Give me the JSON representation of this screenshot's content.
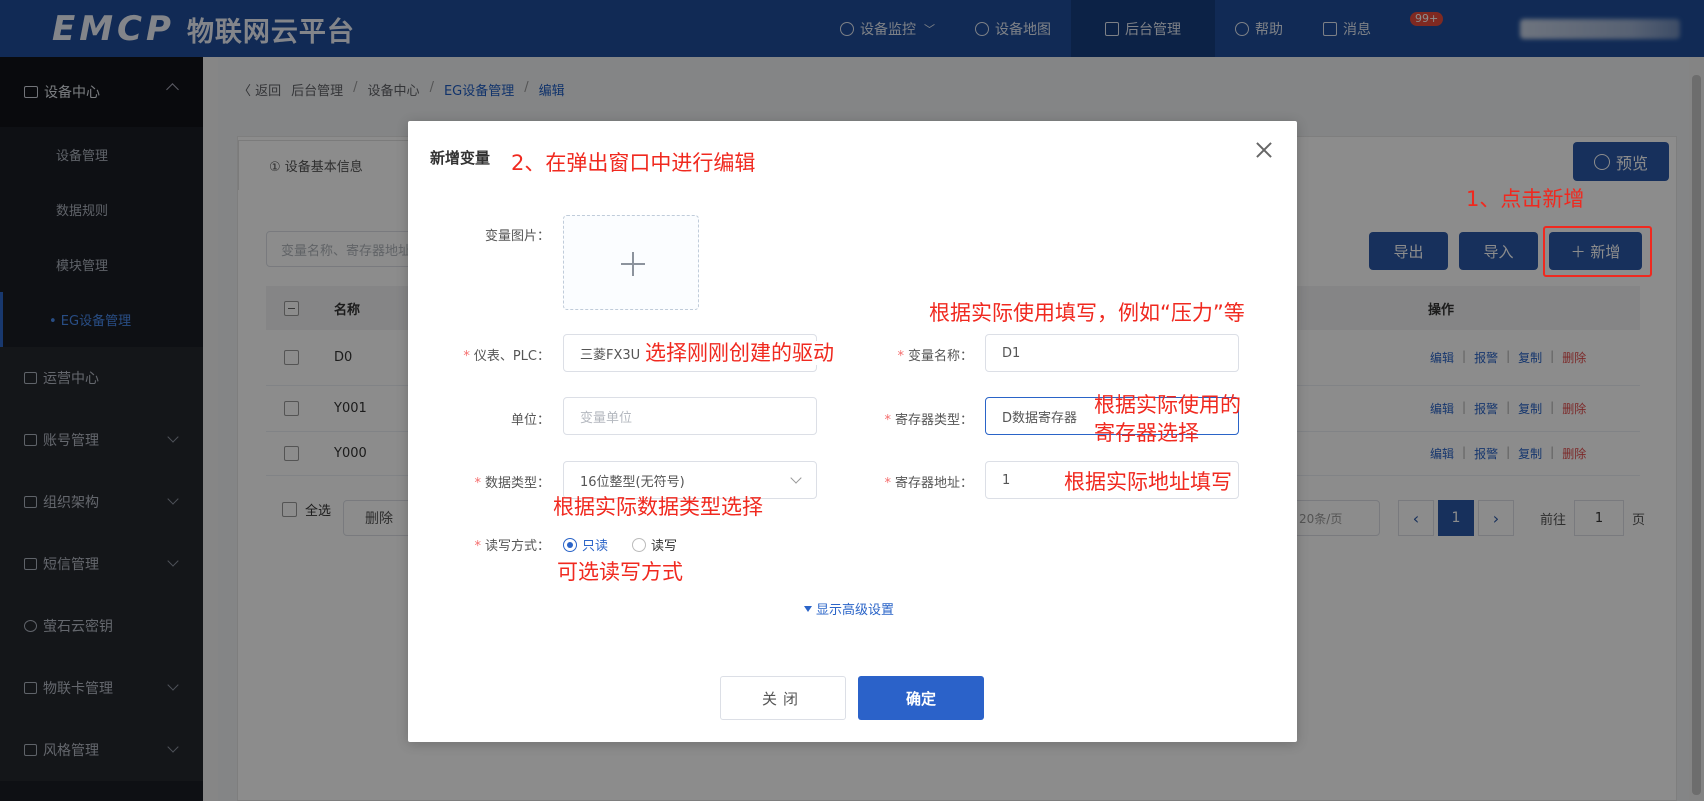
{
  "header": {
    "logo_mark": "EMCP",
    "logo_text": "物联网云平台",
    "nav": [
      {
        "label": "设备监控",
        "icon": "location-pin-icon"
      },
      {
        "label": "设备地图",
        "icon": "user-icon"
      },
      {
        "label": "后台管理",
        "icon": "monitor-icon",
        "active": true
      },
      {
        "label": "帮助",
        "icon": "help-icon"
      },
      {
        "label": "消息",
        "icon": "message-icon"
      }
    ],
    "badge": "99+"
  },
  "sidebar": {
    "group": "设备中心",
    "subitems": [
      "设备管理",
      "数据规则",
      "模块管理",
      "• EG设备管理"
    ],
    "menus": [
      "运营中心",
      "账号管理",
      "组织架构",
      "短信管理",
      "萤石云密钥",
      "物联卡管理",
      "风格管理"
    ]
  },
  "breadcrumb": {
    "back": "〈 返回",
    "items": [
      "后台管理",
      "/",
      "设备中心",
      "/",
      "EG设备管理",
      "/",
      "编辑"
    ]
  },
  "page": {
    "tab_basic": "① 设备基本信息",
    "preview": "预览",
    "export": "导出",
    "import": "导入",
    "add": "＋ 新增",
    "search_placeholder": "变量名称、寄存器地址",
    "table": {
      "col_name": "名称",
      "col_ops": "操作",
      "rows": [
        "D0",
        "Y001",
        "Y000"
      ],
      "ops": [
        "编辑",
        "报警",
        "复制",
        "删除"
      ]
    },
    "select_all": "全选",
    "delete": "删除",
    "page_size": "20条/页",
    "prev": "‹",
    "current_page": "1",
    "next": "›",
    "goto_label": "前往",
    "goto_value": "1",
    "page_unit": "页"
  },
  "dialog": {
    "title": "新增变量",
    "labels": {
      "image": "变量图片：",
      "plc": "仪表、PLC：",
      "var_name": "变量名称：",
      "unit": "单位：",
      "reg_type": "寄存器类型：",
      "data_type": "数据类型：",
      "reg_addr": "寄存器地址：",
      "rw": "读写方式："
    },
    "values": {
      "plc": "三菱FX3U",
      "var_name": "D1",
      "unit_placeholder": "变量单位",
      "reg_type": "D数据寄存器",
      "data_type": "16位整型(无符号)",
      "reg_addr": "1"
    },
    "rw_options": [
      {
        "label": "只读",
        "checked": true
      },
      {
        "label": "读写",
        "checked": false
      }
    ],
    "advanced": "显示高级设置",
    "close": "关闭",
    "confirm": "确定"
  },
  "annotations": {
    "step2": "2、在弹出窗口中进行编辑",
    "step1": "1、点击新增",
    "fill_name": "根据实际使用填写，例如“压力”等",
    "select_driver": "选择刚刚创建的驱动",
    "reg_select_1": "根据实际使用的",
    "reg_select_2": "寄存器选择",
    "addr_fill": "根据实际地址填写",
    "datatype_select": "根据实际数据类型选择",
    "rw_select": "可选读写方式"
  },
  "colors": {
    "header": "#1f4e9c",
    "primary": "#2a58a8",
    "annotation": "#f0291f",
    "sidebar": "#1b1e26"
  }
}
